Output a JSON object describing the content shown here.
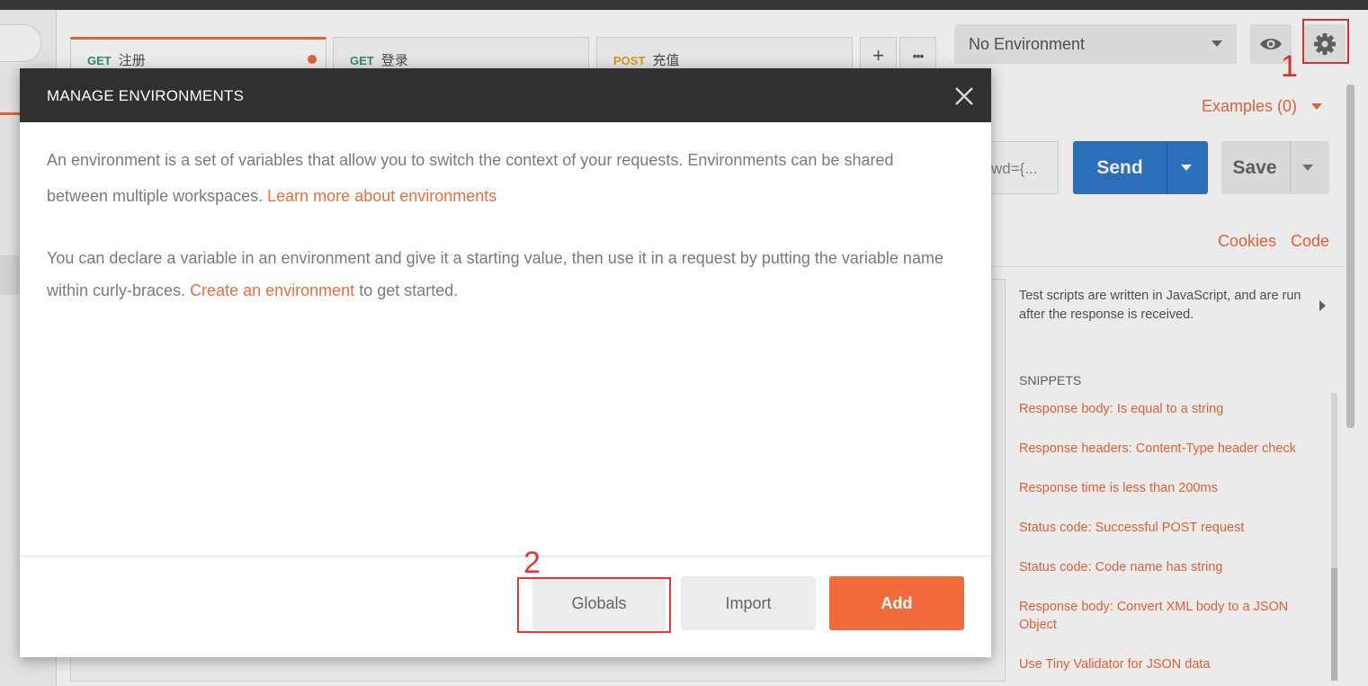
{
  "tabs": [
    {
      "method": "GET",
      "name": "注册"
    },
    {
      "method": "GET",
      "name": "登录"
    },
    {
      "method": "POST",
      "name": "充值"
    }
  ],
  "tab_actions": {
    "add": "+",
    "more": "•••"
  },
  "environment": {
    "selected": "No Environment"
  },
  "annotations": {
    "gear_marker": "1",
    "globals_marker": "2"
  },
  "request": {
    "examples_label": "Examples (0)",
    "url_tail": "wd={...",
    "send_label": "Send",
    "save_label": "Save",
    "cookies_label": "Cookies",
    "code_label": "Code"
  },
  "tests_panel": {
    "description": "Test scripts are written in JavaScript, and are run after the response is received.",
    "snippets_title": "SNIPPETS",
    "snippets": [
      "Response body: Is equal to a string",
      "Response headers: Content-Type header check",
      "Response time is less than 200ms",
      "Status code: Successful POST request",
      "Status code: Code name has string",
      "Response body: Convert XML body to a JSON Object",
      "Use Tiny Validator for JSON data"
    ]
  },
  "modal": {
    "title": "MANAGE ENVIRONMENTS",
    "paragraph1_text": "An environment is a set of variables that allow you to switch the context of your requests. Environments can be shared between multiple workspaces.",
    "paragraph1_link": "Learn more about environments",
    "paragraph2_text": "You can declare a variable in an environment and give it a starting value, then use it in a request by putting the variable name within curly-braces.",
    "paragraph2_link": "Create an environment",
    "paragraph2_tail": "to get started.",
    "buttons": {
      "globals": "Globals",
      "import": "Import",
      "add": "Add"
    }
  },
  "colors": {
    "accent": "#f26b3a",
    "send_blue": "#2f78c9",
    "header_dark": "#303030",
    "annotation_red": "#e53935",
    "method_get": "#2d9d6a",
    "method_post": "#e5a31a"
  }
}
